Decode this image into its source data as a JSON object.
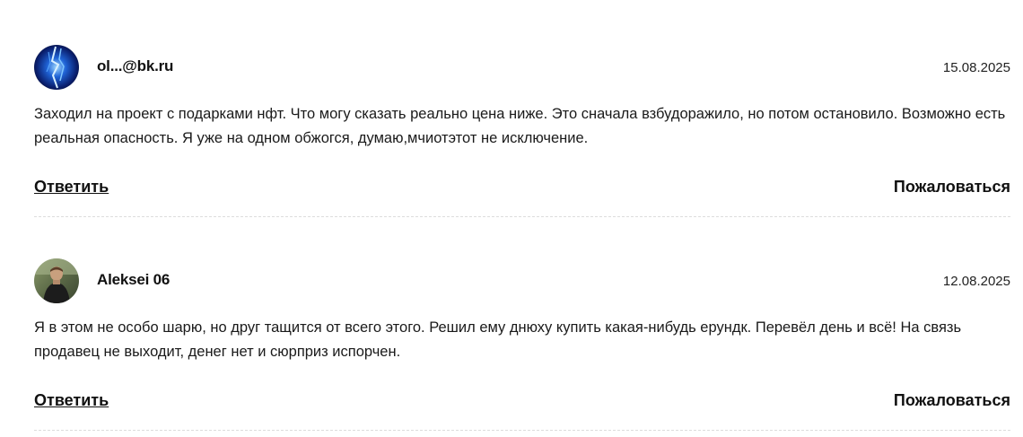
{
  "comments": [
    {
      "author": "ol...@bk.ru",
      "date": "15.08.2025",
      "avatar_icon": "blue-lightning-avatar",
      "text": "Заходил на проект с подарками нфт. Что могу сказать реально цена ниже. Это сначала взбудоражило, но потом остановило. Возможно есть реальная опасность. Я уже на одном обжогся, думаю,мчиотэтот не исключение.",
      "reply_label": "Ответить",
      "report_label": "Пожаловаться"
    },
    {
      "author": "Aleksei 06",
      "date": "12.08.2025",
      "avatar_icon": "person-photo-avatar",
      "text": "Я в этом не особо шарю, но друг тащится от всего этого. Решил ему днюху купить какая-нибудь ерундк. Перевёл день и всё! На связь продавец не выходит, денег нет и сюрприз испорчен.",
      "reply_label": "Ответить",
      "report_label": "Пожаловаться"
    }
  ],
  "colors": {
    "text": "#111111",
    "divider": "#dcdcdc",
    "background": "#ffffff"
  }
}
